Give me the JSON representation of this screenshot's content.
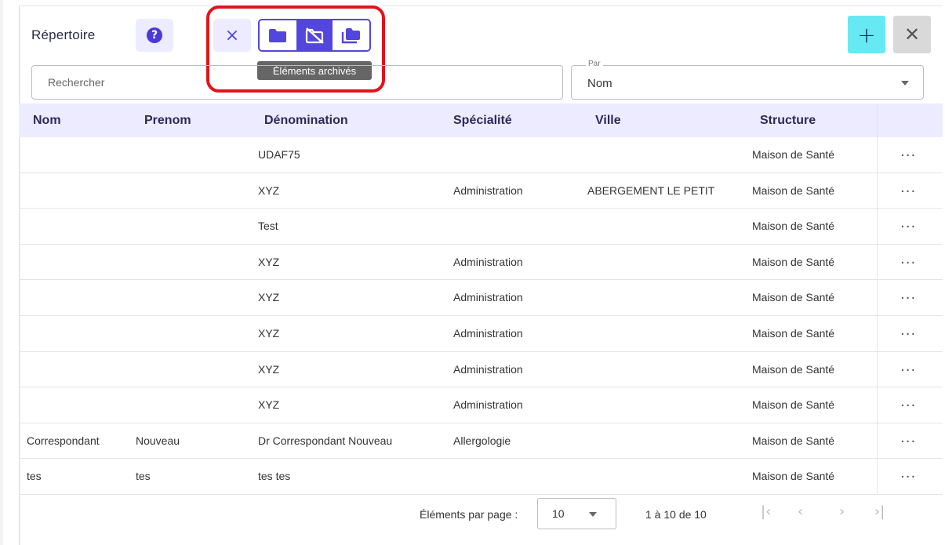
{
  "header": {
    "title": "Répertoire",
    "help_icon": "question-circle-icon",
    "tooltip": "Éléments archivés"
  },
  "search": {
    "placeholder": "Rechercher"
  },
  "sort": {
    "label": "Par",
    "value": "Nom"
  },
  "table": {
    "columns": [
      "Nom",
      "Prenom",
      "Dénomination",
      "Spécialité",
      "Ville",
      "Structure"
    ],
    "rows": [
      {
        "nom": "",
        "prenom": "",
        "denomination": "UDAF75",
        "specialite": "",
        "ville": "",
        "structure": "Maison de Santé"
      },
      {
        "nom": "",
        "prenom": "",
        "denomination": "XYZ",
        "specialite": "Administration",
        "ville": "ABERGEMENT LE PETIT",
        "structure": "Maison de Santé"
      },
      {
        "nom": "",
        "prenom": "",
        "denomination": "Test",
        "specialite": "",
        "ville": "",
        "structure": "Maison de Santé"
      },
      {
        "nom": "",
        "prenom": "",
        "denomination": "XYZ",
        "specialite": "Administration",
        "ville": "",
        "structure": "Maison de Santé"
      },
      {
        "nom": "",
        "prenom": "",
        "denomination": "XYZ",
        "specialite": "Administration",
        "ville": "",
        "structure": "Maison de Santé"
      },
      {
        "nom": "",
        "prenom": "",
        "denomination": "XYZ",
        "specialite": "Administration",
        "ville": "",
        "structure": "Maison de Santé"
      },
      {
        "nom": "",
        "prenom": "",
        "denomination": "XYZ",
        "specialite": "Administration",
        "ville": "",
        "structure": "Maison de Santé"
      },
      {
        "nom": "",
        "prenom": "",
        "denomination": "XYZ",
        "specialite": "Administration",
        "ville": "",
        "structure": "Maison de Santé"
      },
      {
        "nom": "Correspondant",
        "prenom": "Nouveau",
        "denomination": "Dr Correspondant Nouveau",
        "specialite": "Allergologie",
        "ville": "",
        "structure": "Maison de Santé"
      },
      {
        "nom": "tes",
        "prenom": "tes",
        "denomination": "tes tes",
        "specialite": "",
        "ville": "",
        "structure": "Maison de Santé"
      }
    ],
    "row_action": "..."
  },
  "pagination": {
    "per_page_label": "Éléments par page :",
    "per_page_value": "10",
    "range_label": "1 à 10 de 10"
  },
  "colors": {
    "accent": "#5346dc",
    "accent_light": "#ecebff",
    "add_button": "#67e9f4",
    "highlight": "#e3131b"
  }
}
